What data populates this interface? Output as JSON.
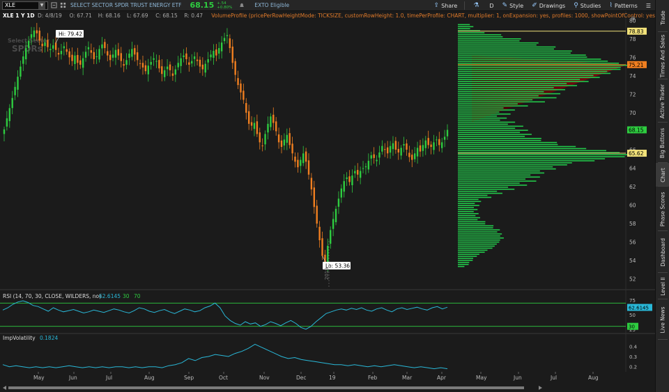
{
  "header": {
    "symbol": "XLE",
    "company": "SELECT SECTOR SPDR TRUST ENERGY ETF",
    "last": "68.15",
    "change_abs": "+.54",
    "change_pct": "+0.80%",
    "exto": "EXTO Eligible"
  },
  "toolbar": {
    "share": "Share",
    "period": "D",
    "style": "Style",
    "drawings": "Drawings",
    "studies": "Studies",
    "patterns": "Patterns"
  },
  "side_tabs": [
    "Trade",
    "Times And Sales",
    "Active Trader",
    "Big Buttons",
    "Chart",
    "Phase Scores",
    "Dashboard",
    "Level II",
    "Live News"
  ],
  "side_tab_active": "Chart",
  "chart_info": {
    "title": "XLE 1 Y 1D",
    "date": "D: 4/8/19",
    "open": "O: 67.71",
    "high": "H: 68.16",
    "low": "L: 67.69",
    "close": "C: 68.15",
    "range": "R: 0.47",
    "study": "VolumeProfile (pricePerRowHeightMode: TICKSIZE, customRowHeight: 1.0, timePerProfile: CHART, multiplier: 1, onExpansion: yes, profiles: 1000, showPointOfControl: yes,..."
  },
  "watermark": {
    "line1": "Select Sector",
    "line2": "SPDRs"
  },
  "annotations": {
    "hi": "Hi: 79.42",
    "lo": "Lo: 53.36"
  },
  "price_axis": {
    "ticks": [
      "80",
      "78",
      "76",
      "74",
      "72",
      "70",
      "68",
      "66",
      "64",
      "62",
      "60",
      "58",
      "56",
      "54",
      "52"
    ],
    "labels": [
      {
        "text": "78.83",
        "kind": "va"
      },
      {
        "text": "75.21",
        "kind": "poc"
      },
      {
        "text": "68.15",
        "kind": "last"
      },
      {
        "text": "65.62",
        "kind": "va"
      }
    ]
  },
  "month_labels": [
    "May",
    "Jun",
    "Jul",
    "Aug",
    "Sep",
    "Oct",
    "Nov",
    "Dec",
    "19",
    "Feb",
    "Mar",
    "Apr",
    "May",
    "Jun",
    "Jul",
    "Aug"
  ],
  "cursor_year": "2019",
  "rsi": {
    "label": "RSI (14, 70, 30, CLOSE, WILDERS, no)",
    "value": "62.6145",
    "lower": "30",
    "upper": "70",
    "axis": [
      "75",
      "50",
      "25"
    ],
    "tag_value": "62.6145",
    "tag_lower": "30"
  },
  "impvol": {
    "label": "ImpVolatility",
    "value": "0.1824",
    "axis": [
      "0.4",
      "0.3",
      "0.2"
    ]
  },
  "colors": {
    "up": "#2ecc40",
    "down": "#f07f20",
    "poc": "#f07f20",
    "value_area": "#f2e27a",
    "rsi": "#29b8d8",
    "impvol": "#29b8d8",
    "profile_green": "#22c84a",
    "profile_red": "#6b0e0e"
  },
  "chart_data": {
    "type": "candlestick",
    "price_range": [
      51,
      81
    ],
    "closes": [
      68.2,
      69.4,
      70.5,
      71.6,
      72.8,
      73.9,
      75.0,
      76.1,
      77.0,
      77.8,
      78.5,
      78.9,
      78.6,
      77.8,
      77.2,
      77.6,
      77.1,
      76.9,
      77.3,
      76.8,
      76.3,
      76.7,
      77.2,
      76.6,
      76.0,
      75.6,
      76.2,
      75.4,
      75.2,
      75.9,
      76.6,
      77.1,
      76.5,
      75.8,
      76.1,
      76.9,
      77.4,
      77.0,
      76.2,
      75.7,
      76.3,
      76.8,
      76.2,
      75.6,
      75.1,
      75.7,
      76.4,
      76.9,
      76.3,
      75.7,
      75.3,
      74.9,
      74.5,
      75.1,
      75.5,
      75.9,
      75.6,
      74.8,
      74.2,
      74.6,
      75.0,
      74.6,
      74.0,
      74.7,
      75.4,
      75.9,
      76.2,
      75.8,
      75.2,
      75.6,
      76.1,
      75.6,
      75.0,
      74.7,
      75.3,
      75.8,
      76.3,
      76.7,
      76.2,
      77.0,
      77.6,
      78.1,
      78.4,
      77.0,
      75.4,
      74.1,
      73.0,
      72.2,
      71.4,
      70.0,
      68.8,
      68.6,
      68.9,
      67.7,
      66.8,
      66.4,
      67.7,
      68.8,
      69.6,
      68.9,
      68.0,
      66.8,
      66.3,
      67.1,
      67.6,
      66.5,
      65.6,
      64.7,
      64.1,
      64.9,
      65.6,
      64.7,
      63.3,
      61.7,
      59.8,
      58.0,
      56.2,
      54.5,
      53.8,
      55.6,
      57.3,
      58.5,
      59.6,
      60.7,
      61.8,
      62.6,
      63.0,
      62.5,
      63.2,
      63.7,
      63.3,
      63.7,
      64.0,
      64.2,
      64.8,
      65.4,
      65.1,
      64.9,
      65.7,
      66.4,
      66.0,
      65.6,
      66.4,
      66.7,
      66.0,
      65.7,
      66.2,
      66.6,
      66.0,
      65.2,
      64.9,
      65.6,
      66.2,
      65.8,
      66.5,
      67.0,
      66.5,
      66.3,
      66.8,
      67.1,
      66.5,
      66.8,
      67.4,
      68.15
    ],
    "high": 79.42,
    "low": 53.36,
    "point_of_control": 75.21,
    "value_area_high": 78.83,
    "value_area_low": 65.62,
    "volume_profile": [
      [
        53.5,
        0.05
      ],
      [
        54.5,
        0.1
      ],
      [
        55.5,
        0.2
      ],
      [
        56.5,
        0.25
      ],
      [
        57.5,
        0.22
      ],
      [
        58.5,
        0.12
      ],
      [
        59.5,
        0.1
      ],
      [
        60.5,
        0.12
      ],
      [
        61.5,
        0.25
      ],
      [
        62.5,
        0.4
      ],
      [
        63.5,
        0.45
      ],
      [
        64.5,
        0.6
      ],
      [
        65.5,
        1.0
      ],
      [
        66.5,
        0.6
      ],
      [
        67.5,
        0.4
      ],
      [
        68.5,
        0.35
      ],
      [
        69.5,
        0.25
      ],
      [
        70.5,
        0.3
      ],
      [
        71.5,
        0.5
      ],
      [
        72.5,
        0.55
      ],
      [
        73.5,
        0.7
      ],
      [
        74.5,
        0.85
      ],
      [
        75.2,
        0.95
      ],
      [
        76.0,
        0.75
      ],
      [
        76.8,
        0.6
      ],
      [
        77.5,
        0.45
      ],
      [
        78.2,
        0.3
      ],
      [
        79.0,
        0.1
      ]
    ],
    "rsi_values": [
      58,
      62,
      68,
      72,
      74,
      71,
      66,
      64,
      60,
      56,
      62,
      58,
      55,
      57,
      59,
      56,
      53,
      55,
      58,
      56,
      54,
      57,
      60,
      58,
      55,
      53,
      57,
      62,
      60,
      56,
      54,
      57,
      59,
      55,
      52,
      56,
      60,
      58,
      55,
      57,
      62,
      65,
      70,
      62,
      48,
      40,
      35,
      32,
      38,
      34,
      36,
      30,
      33,
      38,
      35,
      31,
      36,
      40,
      35,
      28,
      25,
      30,
      38,
      45,
      52,
      55,
      58,
      60,
      58,
      61,
      59,
      62,
      58,
      56,
      60,
      62,
      58,
      55,
      60,
      62,
      59,
      61,
      63,
      60,
      58,
      62,
      64,
      60,
      63
    ],
    "impvol_values": [
      0.22,
      0.2,
      0.21,
      0.2,
      0.19,
      0.2,
      0.19,
      0.2,
      0.19,
      0.2,
      0.21,
      0.2,
      0.19,
      0.2,
      0.19,
      0.2,
      0.19,
      0.2,
      0.2,
      0.19,
      0.2,
      0.19,
      0.2,
      0.2,
      0.19,
      0.21,
      0.22,
      0.24,
      0.28,
      0.26,
      0.29,
      0.3,
      0.32,
      0.31,
      0.3,
      0.33,
      0.35,
      0.38,
      0.42,
      0.39,
      0.36,
      0.33,
      0.3,
      0.28,
      0.29,
      0.27,
      0.26,
      0.25,
      0.24,
      0.23,
      0.22,
      0.22,
      0.21,
      0.22,
      0.21,
      0.2,
      0.21,
      0.2,
      0.21,
      0.22,
      0.21,
      0.2,
      0.19,
      0.2,
      0.19,
      0.18,
      0.19,
      0.18
    ]
  }
}
